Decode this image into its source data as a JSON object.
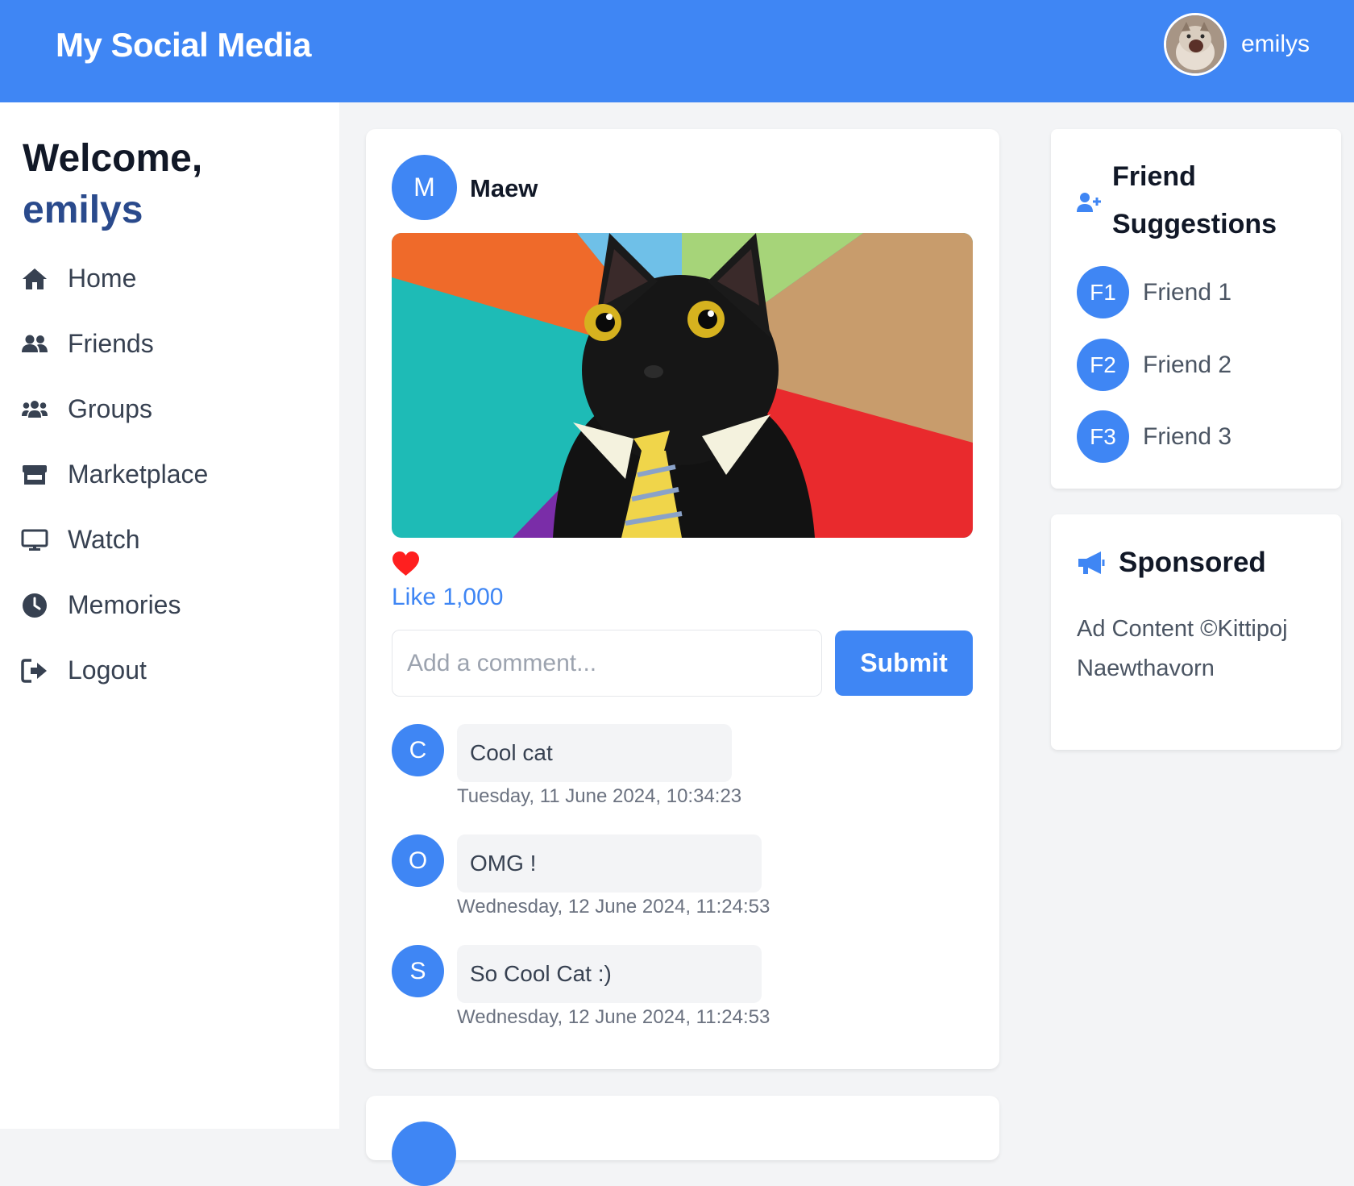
{
  "header": {
    "brand": "My Social Media",
    "username": "emilys"
  },
  "sidebar": {
    "welcome": "Welcome,",
    "username": "emilys",
    "items": [
      {
        "label": "Home",
        "icon": "home-icon"
      },
      {
        "label": "Friends",
        "icon": "friends-icon"
      },
      {
        "label": "Groups",
        "icon": "groups-icon"
      },
      {
        "label": "Marketplace",
        "icon": "store-icon"
      },
      {
        "label": "Watch",
        "icon": "monitor-icon"
      },
      {
        "label": "Memories",
        "icon": "clock-icon"
      },
      {
        "label": "Logout",
        "icon": "logout-icon"
      }
    ]
  },
  "post": {
    "author_initial": "M",
    "author": "Maew",
    "image_alt": "cat-in-tie-photo",
    "like_label": "Like 1,000",
    "comment_placeholder": "Add a comment...",
    "submit_label": "Submit",
    "comments": [
      {
        "initial": "C",
        "text": "Cool cat",
        "time": "Tuesday, 11 June 2024, 10:34:23"
      },
      {
        "initial": "O",
        "text": "OMG !",
        "time": "Wednesday, 12 June 2024, 11:24:53"
      },
      {
        "initial": "S",
        "text": "So Cool Cat :)",
        "time": "Wednesday, 12 June 2024, 11:24:53"
      }
    ]
  },
  "friend_suggestions": {
    "title": "Friend Suggestions",
    "items": [
      {
        "initial": "F1",
        "name": "Friend 1"
      },
      {
        "initial": "F2",
        "name": "Friend 2"
      },
      {
        "initial": "F3",
        "name": "Friend 3"
      }
    ]
  },
  "sponsored": {
    "title": "Sponsored",
    "content": "Ad Content ©Kittipoj Naewthavorn"
  },
  "colors": {
    "primary": "#3f86f4",
    "welcome_name": "#2a4a8c",
    "like_heart": "#ff1f1f",
    "page_background": "#f3f4f6"
  }
}
